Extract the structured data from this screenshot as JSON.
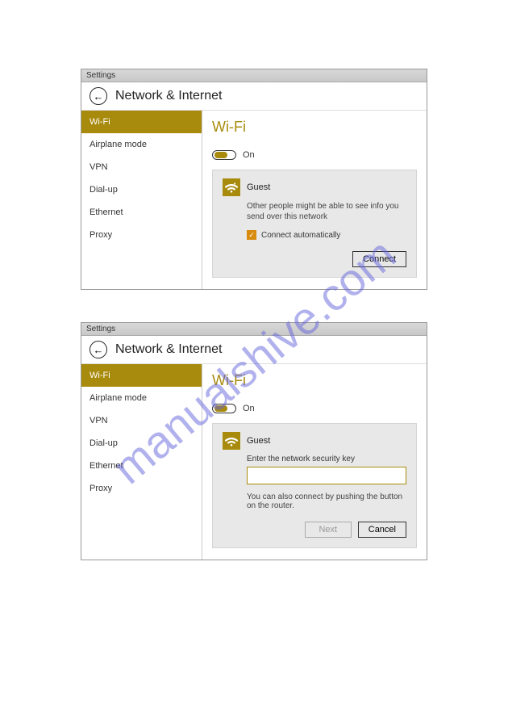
{
  "watermark": "manualshive.com",
  "colors": {
    "accent": "#a88b0d"
  },
  "window1": {
    "titlebar": "Settings",
    "header": "Network & Internet",
    "sidebar": [
      "Wi-Fi",
      "Airplane mode",
      "VPN",
      "Dial-up",
      "Ethernet",
      "Proxy"
    ],
    "activeIndex": 0,
    "page_title": "Wi-Fi",
    "toggle_label": "On",
    "network": {
      "name": "Guest",
      "warning": "Other people might be able to see info you send over this network",
      "checkbox_label": "Connect automatically",
      "connect_button": "Connect"
    }
  },
  "window2": {
    "titlebar": "Settings",
    "header": "Network & Internet",
    "sidebar": [
      "Wi-Fi",
      "Airplane mode",
      "VPN",
      "Dial-up",
      "Ethernet",
      "Proxy"
    ],
    "activeIndex": 0,
    "page_title": "Wi-Fi",
    "toggle_label": "On",
    "network": {
      "name": "Guest",
      "input_label": "Enter the network security key",
      "input_value": "",
      "hint": "You can also connect by pushing the button on the router.",
      "next_button": "Next",
      "cancel_button": "Cancel"
    }
  }
}
